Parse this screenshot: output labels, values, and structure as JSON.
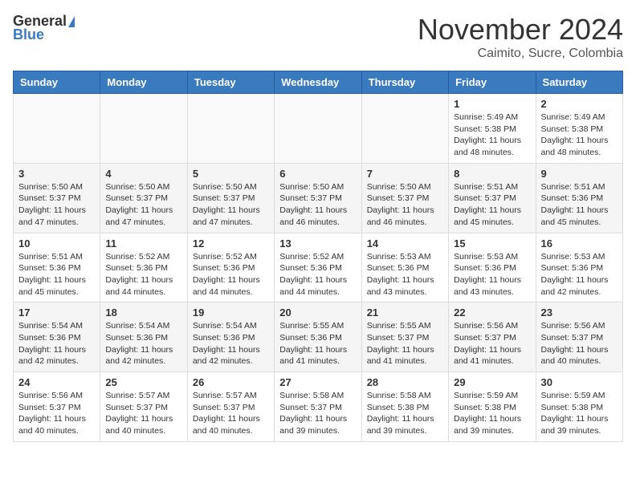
{
  "header": {
    "logo_general": "General",
    "logo_blue": "Blue",
    "month": "November 2024",
    "location": "Caimito, Sucre, Colombia"
  },
  "days_of_week": [
    "Sunday",
    "Monday",
    "Tuesday",
    "Wednesday",
    "Thursday",
    "Friday",
    "Saturday"
  ],
  "weeks": [
    [
      {
        "day": "",
        "info": ""
      },
      {
        "day": "",
        "info": ""
      },
      {
        "day": "",
        "info": ""
      },
      {
        "day": "",
        "info": ""
      },
      {
        "day": "",
        "info": ""
      },
      {
        "day": "1",
        "info": "Sunrise: 5:49 AM\nSunset: 5:38 PM\nDaylight: 11 hours and 48 minutes."
      },
      {
        "day": "2",
        "info": "Sunrise: 5:49 AM\nSunset: 5:38 PM\nDaylight: 11 hours and 48 minutes."
      }
    ],
    [
      {
        "day": "3",
        "info": "Sunrise: 5:50 AM\nSunset: 5:37 PM\nDaylight: 11 hours and 47 minutes."
      },
      {
        "day": "4",
        "info": "Sunrise: 5:50 AM\nSunset: 5:37 PM\nDaylight: 11 hours and 47 minutes."
      },
      {
        "day": "5",
        "info": "Sunrise: 5:50 AM\nSunset: 5:37 PM\nDaylight: 11 hours and 47 minutes."
      },
      {
        "day": "6",
        "info": "Sunrise: 5:50 AM\nSunset: 5:37 PM\nDaylight: 11 hours and 46 minutes."
      },
      {
        "day": "7",
        "info": "Sunrise: 5:50 AM\nSunset: 5:37 PM\nDaylight: 11 hours and 46 minutes."
      },
      {
        "day": "8",
        "info": "Sunrise: 5:51 AM\nSunset: 5:37 PM\nDaylight: 11 hours and 45 minutes."
      },
      {
        "day": "9",
        "info": "Sunrise: 5:51 AM\nSunset: 5:36 PM\nDaylight: 11 hours and 45 minutes."
      }
    ],
    [
      {
        "day": "10",
        "info": "Sunrise: 5:51 AM\nSunset: 5:36 PM\nDaylight: 11 hours and 45 minutes."
      },
      {
        "day": "11",
        "info": "Sunrise: 5:52 AM\nSunset: 5:36 PM\nDaylight: 11 hours and 44 minutes."
      },
      {
        "day": "12",
        "info": "Sunrise: 5:52 AM\nSunset: 5:36 PM\nDaylight: 11 hours and 44 minutes."
      },
      {
        "day": "13",
        "info": "Sunrise: 5:52 AM\nSunset: 5:36 PM\nDaylight: 11 hours and 44 minutes."
      },
      {
        "day": "14",
        "info": "Sunrise: 5:53 AM\nSunset: 5:36 PM\nDaylight: 11 hours and 43 minutes."
      },
      {
        "day": "15",
        "info": "Sunrise: 5:53 AM\nSunset: 5:36 PM\nDaylight: 11 hours and 43 minutes."
      },
      {
        "day": "16",
        "info": "Sunrise: 5:53 AM\nSunset: 5:36 PM\nDaylight: 11 hours and 42 minutes."
      }
    ],
    [
      {
        "day": "17",
        "info": "Sunrise: 5:54 AM\nSunset: 5:36 PM\nDaylight: 11 hours and 42 minutes."
      },
      {
        "day": "18",
        "info": "Sunrise: 5:54 AM\nSunset: 5:36 PM\nDaylight: 11 hours and 42 minutes."
      },
      {
        "day": "19",
        "info": "Sunrise: 5:54 AM\nSunset: 5:36 PM\nDaylight: 11 hours and 42 minutes."
      },
      {
        "day": "20",
        "info": "Sunrise: 5:55 AM\nSunset: 5:36 PM\nDaylight: 11 hours and 41 minutes."
      },
      {
        "day": "21",
        "info": "Sunrise: 5:55 AM\nSunset: 5:37 PM\nDaylight: 11 hours and 41 minutes."
      },
      {
        "day": "22",
        "info": "Sunrise: 5:56 AM\nSunset: 5:37 PM\nDaylight: 11 hours and 41 minutes."
      },
      {
        "day": "23",
        "info": "Sunrise: 5:56 AM\nSunset: 5:37 PM\nDaylight: 11 hours and 40 minutes."
      }
    ],
    [
      {
        "day": "24",
        "info": "Sunrise: 5:56 AM\nSunset: 5:37 PM\nDaylight: 11 hours and 40 minutes."
      },
      {
        "day": "25",
        "info": "Sunrise: 5:57 AM\nSunset: 5:37 PM\nDaylight: 11 hours and 40 minutes."
      },
      {
        "day": "26",
        "info": "Sunrise: 5:57 AM\nSunset: 5:37 PM\nDaylight: 11 hours and 40 minutes."
      },
      {
        "day": "27",
        "info": "Sunrise: 5:58 AM\nSunset: 5:37 PM\nDaylight: 11 hours and 39 minutes."
      },
      {
        "day": "28",
        "info": "Sunrise: 5:58 AM\nSunset: 5:38 PM\nDaylight: 11 hours and 39 minutes."
      },
      {
        "day": "29",
        "info": "Sunrise: 5:59 AM\nSunset: 5:38 PM\nDaylight: 11 hours and 39 minutes."
      },
      {
        "day": "30",
        "info": "Sunrise: 5:59 AM\nSunset: 5:38 PM\nDaylight: 11 hours and 39 minutes."
      }
    ]
  ]
}
